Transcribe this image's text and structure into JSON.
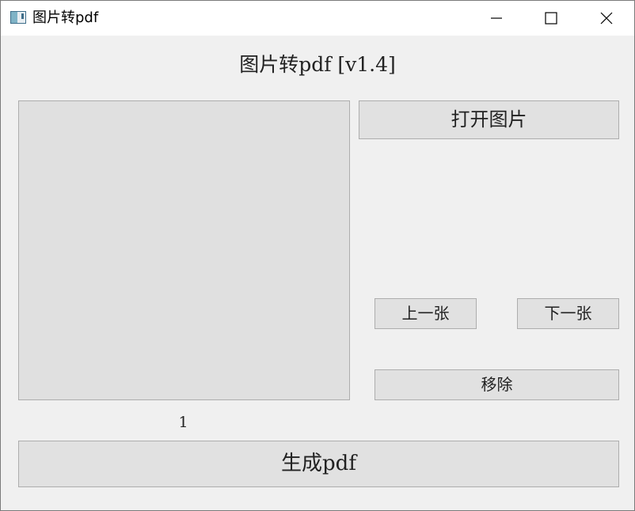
{
  "window": {
    "title": "图片转pdf",
    "icons": {
      "app": "image-window-icon",
      "minimize": "minimize-icon",
      "maximize": "maximize-icon",
      "close": "close-icon"
    }
  },
  "main": {
    "heading": "图片转pdf [v1.4]",
    "open_label": "打开图片",
    "prev_label": "上一张",
    "next_label": "下一张",
    "remove_label": "移除",
    "page_number": "1",
    "generate_label": "生成pdf"
  },
  "colors": {
    "background": "#f0f0f0",
    "button": "#e1e1e1",
    "button_border": "#adadad",
    "titlebar": "#ffffff"
  }
}
